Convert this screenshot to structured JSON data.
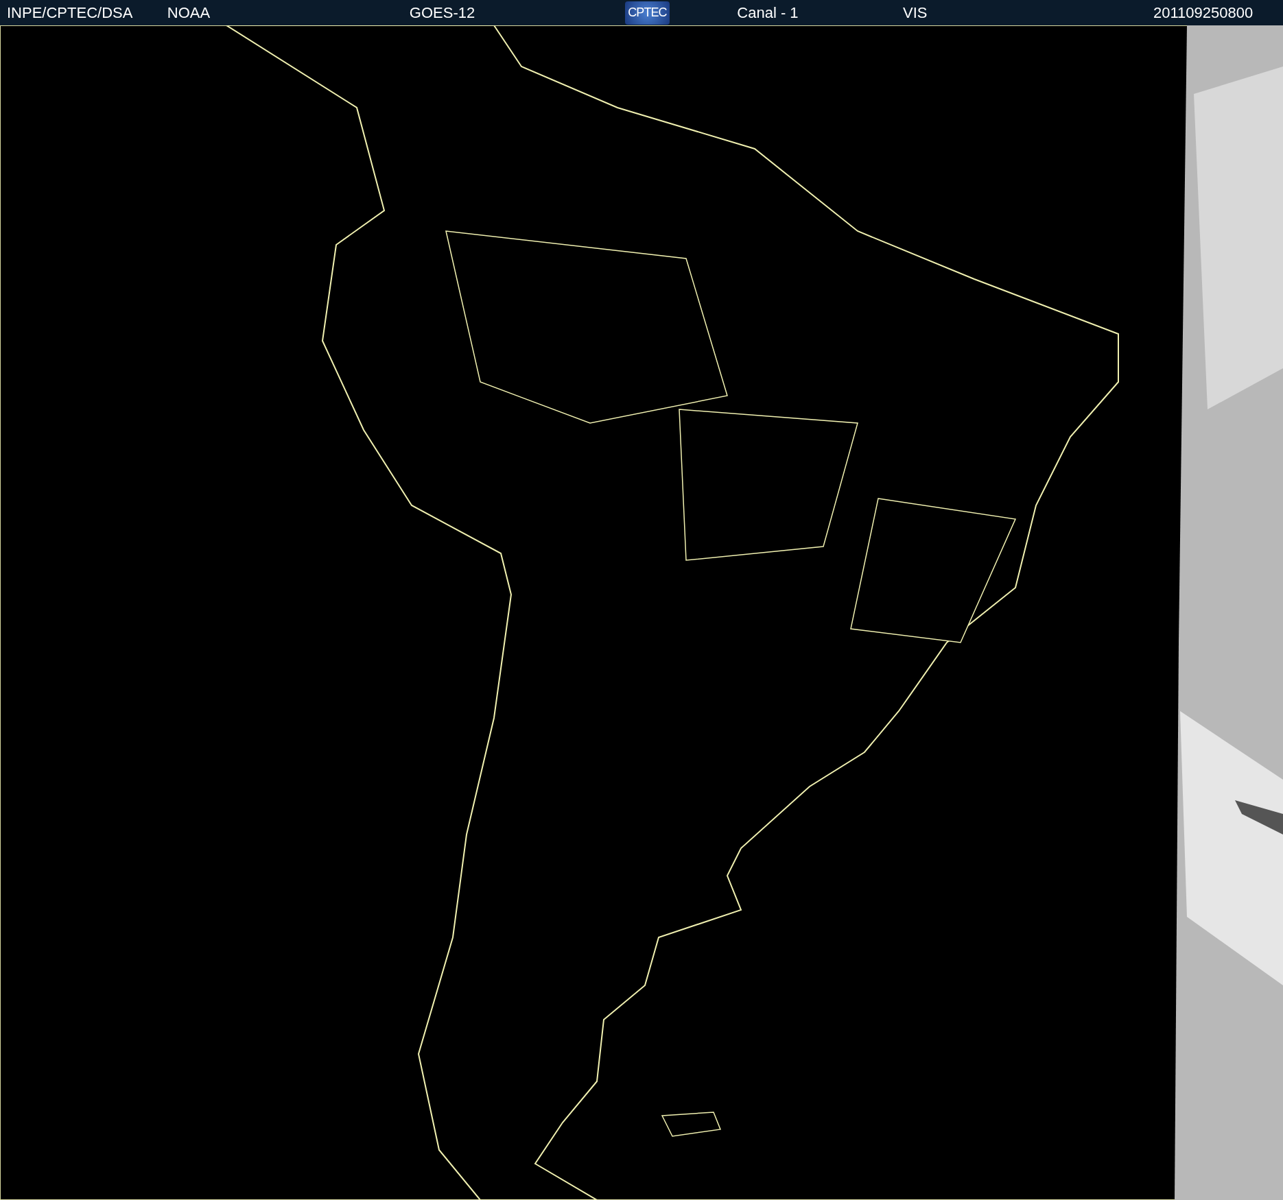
{
  "header": {
    "items": [
      {
        "kind": "text",
        "text": "INPE/CPTEC/DSA"
      },
      {
        "kind": "text",
        "text": "NOAA"
      },
      {
        "kind": "text",
        "text": "GOES-12"
      },
      {
        "kind": "logo",
        "text": "CPTEC"
      },
      {
        "kind": "text",
        "text": "Canal - 1"
      },
      {
        "kind": "text",
        "text": "VIS"
      },
      {
        "kind": "text",
        "text": "201109250800"
      }
    ]
  }
}
